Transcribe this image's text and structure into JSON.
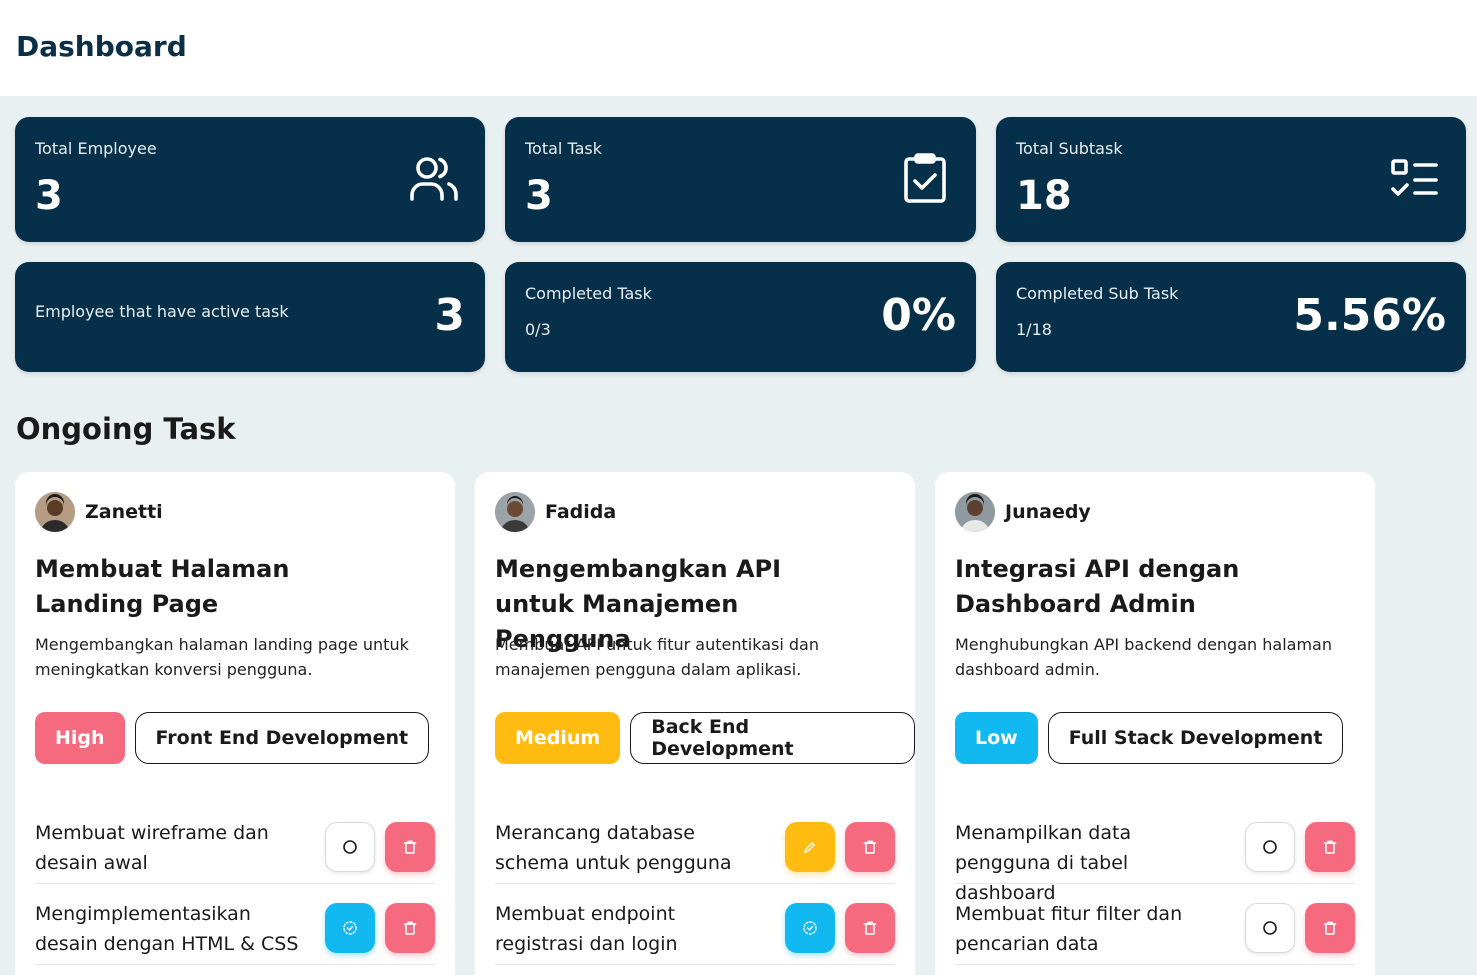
{
  "header": {
    "title": "Dashboard"
  },
  "stats": {
    "total_employee": {
      "label": "Total Employee",
      "value": "3",
      "icon": "users-icon"
    },
    "total_task": {
      "label": "Total Task",
      "value": "3",
      "icon": "clipboard-check-icon"
    },
    "total_subtask": {
      "label": "Total Subtask",
      "value": "18",
      "icon": "checklist-icon"
    },
    "active_employee": {
      "label": "Employee that have active task",
      "value": "3"
    },
    "completed_task": {
      "label": "Completed Task",
      "fraction": "0/3",
      "percent": "0%"
    },
    "completed_subtask": {
      "label": "Completed Sub Task",
      "fraction": "1/18",
      "percent": "5.56%"
    }
  },
  "ongoing": {
    "title": "Ongoing Task",
    "cards": [
      {
        "user": "Zanetti",
        "title": "Membuat Halaman Landing Page",
        "description": "Mengembangkan halaman landing page untuk meningkatkan konversi pengguna.",
        "priority": "High",
        "priority_color": "#f56a7e",
        "category": "Front End Development",
        "subtasks": [
          {
            "text": "Membuat wireframe dan desain awal",
            "status": "not-started"
          },
          {
            "text": "Mengimplementasikan desain dengan HTML & CSS",
            "status": "in-progress"
          }
        ]
      },
      {
        "user": "Fadida",
        "title": "Mengembangkan API untuk Manajemen Pengguna",
        "description": "Membuat API untuk fitur autentikasi dan manajemen pengguna dalam aplikasi.",
        "priority": "Medium",
        "priority_color": "#ffbb0f",
        "category": "Back End Development",
        "subtasks": [
          {
            "text": "Merancang database schema untuk pengguna",
            "status": "editing"
          },
          {
            "text": "Membuat endpoint registrasi dan login",
            "status": "in-progress"
          }
        ]
      },
      {
        "user": "Junaedy",
        "title": "Integrasi API dengan Dashboard Admin",
        "description": "Menghubungkan API backend dengan halaman dashboard admin.",
        "priority": "Low",
        "priority_color": "#12b8f0",
        "category": "Full Stack Development",
        "subtasks": [
          {
            "text": "Menampilkan data pengguna di tabel dashboard",
            "status": "not-started"
          },
          {
            "text": "Membuat fitur filter dan pencarian data",
            "status": "not-started"
          }
        ]
      }
    ]
  },
  "colors": {
    "primary": "#06304a",
    "background": "#e9f0f2",
    "danger": "#f56a7e",
    "info": "#12b8f0",
    "warning": "#ffbb0f"
  }
}
